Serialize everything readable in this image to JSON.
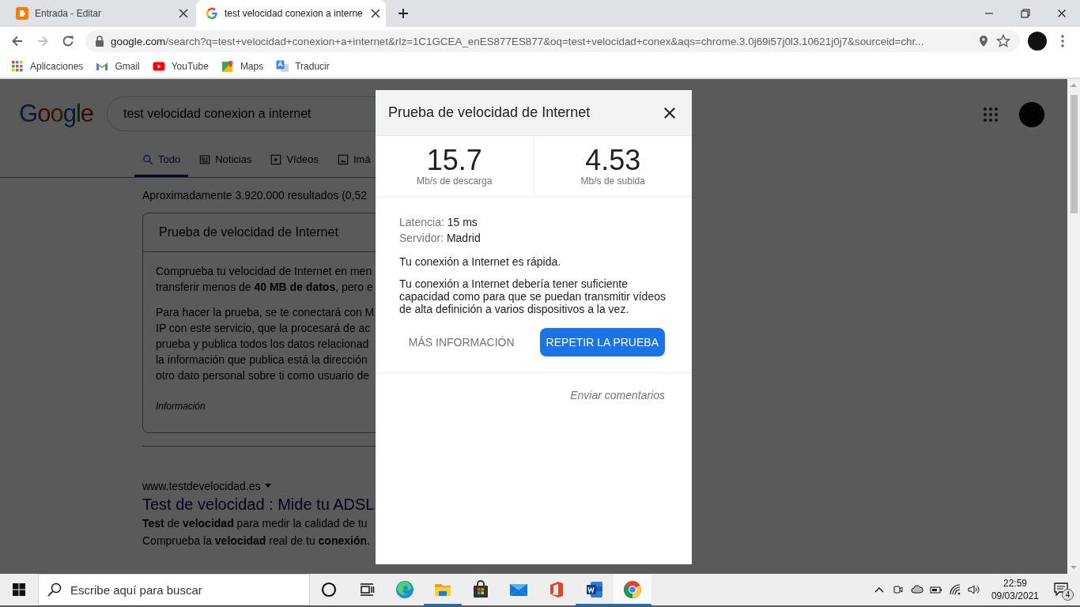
{
  "browser": {
    "tabs": [
      {
        "title": "Entrada - Editar",
        "kind": "blogger",
        "selected": false
      },
      {
        "title": "test velocidad conexion a interne",
        "kind": "google",
        "selected": true
      }
    ],
    "nav": [
      {
        "kind": "back",
        "disabled": false
      },
      {
        "kind": "forward",
        "disabled": true
      },
      {
        "kind": "reload",
        "disabled": false
      }
    ],
    "url_host": "google.com",
    "url_path": "/search?q=test+velocidad+conexion+a+internet&rlz=1C1GCEA_enES877ES877&oq=test+velocidad+conex&aqs=chrome.3.0j69i57j0l3.10621j0j7&sourceid=chr...",
    "bookmarks": [
      {
        "label": "Aplicaciones",
        "kind": "apps"
      },
      {
        "label": "Gmail",
        "kind": "gmail"
      },
      {
        "label": "YouTube",
        "kind": "youtube"
      },
      {
        "label": "Maps",
        "kind": "maps"
      },
      {
        "label": "Traducir",
        "kind": "translate"
      }
    ]
  },
  "page": {
    "logo": "Google",
    "query": "test velocidad conexion a internet",
    "tabs": [
      {
        "label": "Todo",
        "kind": "search",
        "selected": true
      },
      {
        "label": "Noticias",
        "kind": "news",
        "selected": false
      },
      {
        "label": "Vídeos",
        "kind": "video",
        "selected": false
      },
      {
        "label": "Imá",
        "kind": "image",
        "selected": false
      }
    ],
    "stats": "Aproximadamente 3.920.000 resultados (0,52",
    "card": {
      "title": "Prueba de velocidad de Internet",
      "paragraphs": [
        [
          "Comprueba tu velocidad de Internet en men",
          "transferir menos de **40 MB de datos**, pero e"
        ],
        [
          "Para hacer la prueba, se te conectará con M",
          "IP con este servicio, que la procesará de ac",
          "prueba y publica todos los datos relacionad",
          "la información que publica está la dirección",
          "otro dato personal sobre ti como usuario de"
        ]
      ],
      "source": "Información"
    },
    "result": {
      "url": "www.testdevelocidad.es",
      "title": "Test de velocidad : Mide tu ADSL",
      "snippet": [
        "**Test** de **velocidad** para medir la calidad de tu",
        "Comprueba la **velocidad** real de tu **conexión**."
      ]
    }
  },
  "dialog": {
    "title": "Prueba de velocidad de Internet",
    "metrics": [
      {
        "value": "15.7",
        "label": "Mb/s de descarga"
      },
      {
        "value": "4.53",
        "label": "Mb/s de subida"
      }
    ],
    "details": [
      {
        "label": "Latencia:",
        "value": "15 ms"
      },
      {
        "label": "Servidor:",
        "value": "Madrid"
      }
    ],
    "summary": "Tu conexión a Internet es rápida.",
    "description": [
      "Tu conexión a Internet debería tener suficiente",
      "capacidad como para que se puedan transmitir vídeos",
      "de alta definición a varios dispositivos a la vez."
    ],
    "buttons": [
      {
        "label": "MÁS INFORMACIÓN",
        "kind": "text"
      },
      {
        "label": "REPETIR LA PRUEBA",
        "kind": "primary"
      }
    ],
    "feedback": "Enviar comentarios"
  },
  "taskbar": {
    "search_placeholder": "Escribe aquí para buscar",
    "apps": [
      {
        "kind": "cortana",
        "open": false,
        "selected": false
      },
      {
        "kind": "taskview",
        "open": false,
        "selected": false
      },
      {
        "kind": "edge",
        "open": false,
        "selected": false
      },
      {
        "kind": "explorer",
        "open": true,
        "selected": false
      },
      {
        "kind": "store",
        "open": false,
        "selected": false
      },
      {
        "kind": "mail",
        "open": false,
        "selected": false
      },
      {
        "kind": "office",
        "open": false,
        "selected": false
      },
      {
        "kind": "word",
        "open": true,
        "selected": false
      },
      {
        "kind": "chrome",
        "open": true,
        "selected": true
      }
    ],
    "time": "22:59",
    "date": "09/03/2021",
    "notifications": "4"
  }
}
